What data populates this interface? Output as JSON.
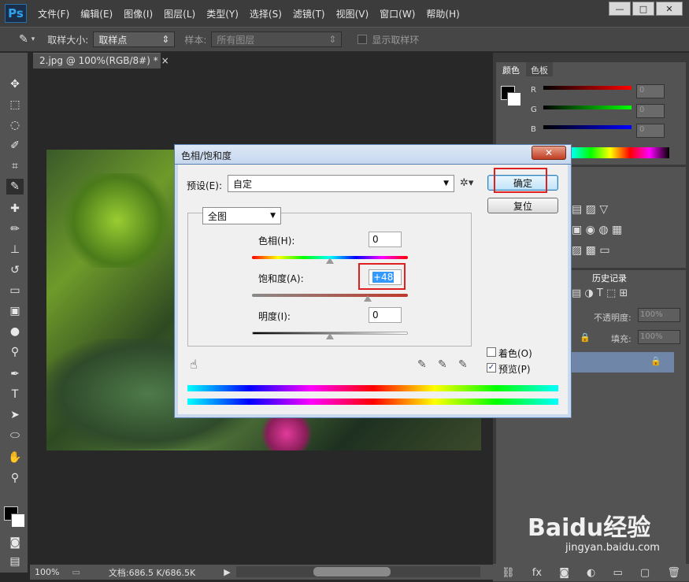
{
  "app": {
    "logo_text": "Ps"
  },
  "menu": [
    "文件(F)",
    "编辑(E)",
    "图像(I)",
    "图层(L)",
    "类型(Y)",
    "选择(S)",
    "滤镜(T)",
    "视图(V)",
    "窗口(W)",
    "帮助(H)"
  ],
  "window_controls": {
    "minimize": "—",
    "maximize": "□",
    "close": "✕"
  },
  "options": {
    "sample_size_label": "取样大小:",
    "sample_size_value": "取样点",
    "sample_label": "样本:",
    "sample_value": "所有图层",
    "show_ring_label": "显示取样环"
  },
  "document": {
    "tab_title": "2.jpg @ 100%(RGB/8#) *",
    "close": "×"
  },
  "status": {
    "zoom": "100%",
    "doc_info": "文档:686.5 K/686.5K"
  },
  "color_panel": {
    "tabs": [
      "颜色",
      "色板"
    ],
    "channels": [
      {
        "label": "R",
        "value": "0"
      },
      {
        "label": "G",
        "value": "0"
      },
      {
        "label": "B",
        "value": "0"
      }
    ]
  },
  "history_panel": {
    "tab": "历史记录"
  },
  "layers_panel": {
    "opacity_label": "不透明度:",
    "opacity_value": "100%",
    "fill_label": "填充:",
    "fill_value": "100%"
  },
  "dialog": {
    "title": "色相/饱和度",
    "close": "✕",
    "preset_label": "预设(E):",
    "preset_value": "自定",
    "ok_label": "确定",
    "reset_label": "复位",
    "channel_value": "全图",
    "hue_label": "色相(H):",
    "hue_value": "0",
    "saturation_label": "饱和度(A):",
    "saturation_value": "+48",
    "lightness_label": "明度(I):",
    "lightness_value": "0",
    "colorize_label": "着色(O)",
    "colorize_checked": false,
    "preview_label": "预览(P)",
    "preview_checked": true
  },
  "watermark": {
    "text": "Baidu经验",
    "sub": "jingyan.baidu.com"
  },
  "colors": {
    "accent_red": "#e02020",
    "selection_blue": "#3399ff",
    "layer_select": "#6f86a8"
  }
}
